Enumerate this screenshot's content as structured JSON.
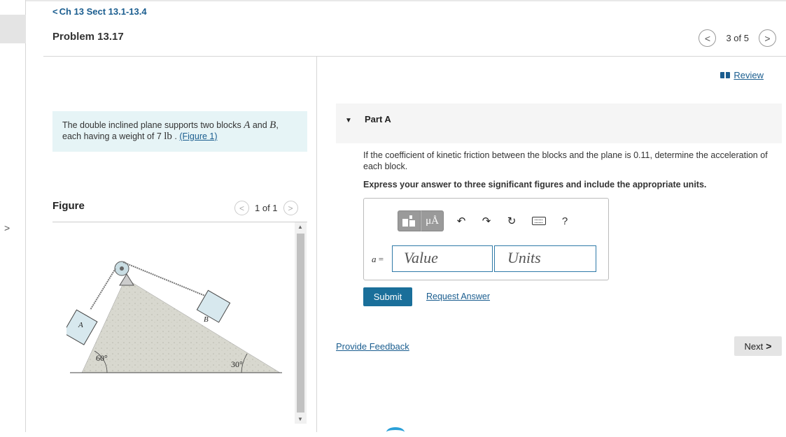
{
  "breadcrumb": {
    "label": "Ch 13 Sect 13.1-13.4"
  },
  "problem": {
    "title": "Problem 13.17"
  },
  "pager": {
    "text": "3 of 5",
    "prev_icon": "<",
    "next_icon": ">"
  },
  "statement": {
    "text_before": "The double inclined plane supports two blocks ",
    "var_a": "A",
    "text_and": " and ",
    "var_b": "B",
    "text_comma": ",",
    "text_weight": "each having a weight of 7 ",
    "unit": "lb",
    "text_dot": " . ",
    "figure_link": "(Figure 1)"
  },
  "figure": {
    "title": "Figure",
    "pager_text": "1 of 1",
    "labels": {
      "block_a": "A",
      "block_b": "B",
      "angle_left": "60°",
      "angle_right": "30°"
    }
  },
  "review": {
    "label": "Review"
  },
  "part": {
    "label": "Part A"
  },
  "question": {
    "text": "If the coefficient of kinetic friction between the blocks and the plane is 0.11, determine the acceleration of each block.",
    "instruction": "Express your answer to three significant figures and include the appropriate units."
  },
  "answer": {
    "label_var": "a",
    "label_eq": " =",
    "value_placeholder": "Value",
    "units_placeholder": "Units",
    "mu_button": "μÅ",
    "help": "?"
  },
  "actions": {
    "submit": "Submit",
    "request_answer": "Request Answer",
    "feedback": "Provide Feedback",
    "next": "Next"
  },
  "colors": {
    "link": "#1a5d8f",
    "submit_bg": "#1a6f9a",
    "statement_bg": "#e6f4f6",
    "input_border": "#2f7aa8"
  }
}
